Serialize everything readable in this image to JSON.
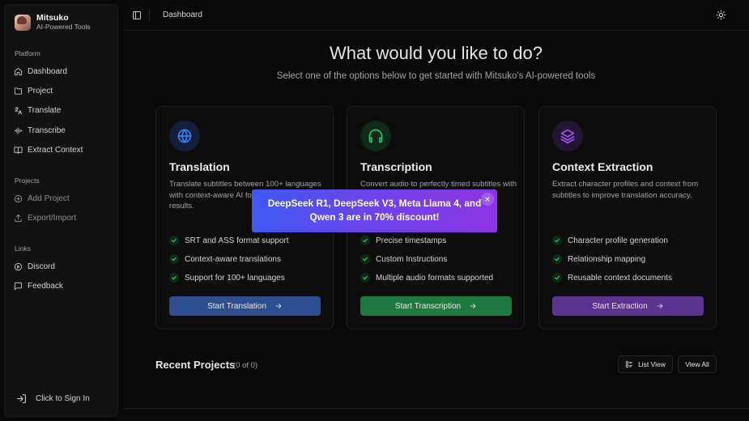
{
  "sidebar": {
    "brand": {
      "name": "Mitsuko",
      "tagline": "AI-Powered Tools"
    },
    "platform_label": "Platform",
    "platform_items": [
      {
        "label": "Dashboard",
        "icon": "home-icon"
      },
      {
        "label": "Project",
        "icon": "folder-icon"
      },
      {
        "label": "Translate",
        "icon": "languages-icon"
      },
      {
        "label": "Transcribe",
        "icon": "audio-lines-icon"
      },
      {
        "label": "Extract Context",
        "icon": "book-open-icon"
      }
    ],
    "projects_label": "Projects",
    "project_items": [
      {
        "label": "Add Project",
        "icon": "plus-circle-icon"
      },
      {
        "label": "Export/Import",
        "icon": "upload-icon"
      }
    ],
    "links_label": "Links",
    "link_items": [
      {
        "label": "Discord",
        "icon": "discord-icon"
      },
      {
        "label": "Feedback",
        "icon": "message-square-icon"
      }
    ],
    "sign_in_label": "Click to Sign In"
  },
  "topbar": {
    "breadcrumb": "Dashboard"
  },
  "hero": {
    "title": "What would you like to do?",
    "subtitle": "Select one of the options below to get started with Mitsuko's AI-powered tools"
  },
  "cards": [
    {
      "title": "Translation",
      "description": "Translate subtitles between 100+ languages with context-aware AI for natural, accurate results.",
      "features": [
        "SRT and ASS format support",
        "Context-aware translations",
        "Support for 100+ languages"
      ],
      "button": "Start Translation",
      "accent": "#3b82f6",
      "button_color": "#2d4f91",
      "icon_bg": "#13203d"
    },
    {
      "title": "Transcription",
      "description": "Convert audio to perfectly timed subtitles with speaker detection.",
      "features": [
        "Precise timestamps",
        "Custom Instructions",
        "Multiple audio formats supported"
      ],
      "button": "Start Transcription",
      "accent": "#22c55e",
      "button_color": "#1d7a3e",
      "icon_bg": "#0f2a17"
    },
    {
      "title": "Context Extraction",
      "description": "Extract character profiles and context from subtitles to improve translation accuracy.",
      "features": [
        "Character profile generation",
        "Relationship mapping",
        "Reusable context documents"
      ],
      "button": "Start Extraction",
      "accent": "#a855f7",
      "button_color": "#5d3290",
      "icon_bg": "#231534"
    }
  ],
  "recent": {
    "title": "Recent Projects",
    "count": "(0 of 0)",
    "list_view_label": "List View",
    "view_all_label": "View All"
  },
  "promo": {
    "message": "DeepSeek R1, DeepSeek V3, Meta Llama 4, and Qwen 3 are in 70% discount!"
  }
}
